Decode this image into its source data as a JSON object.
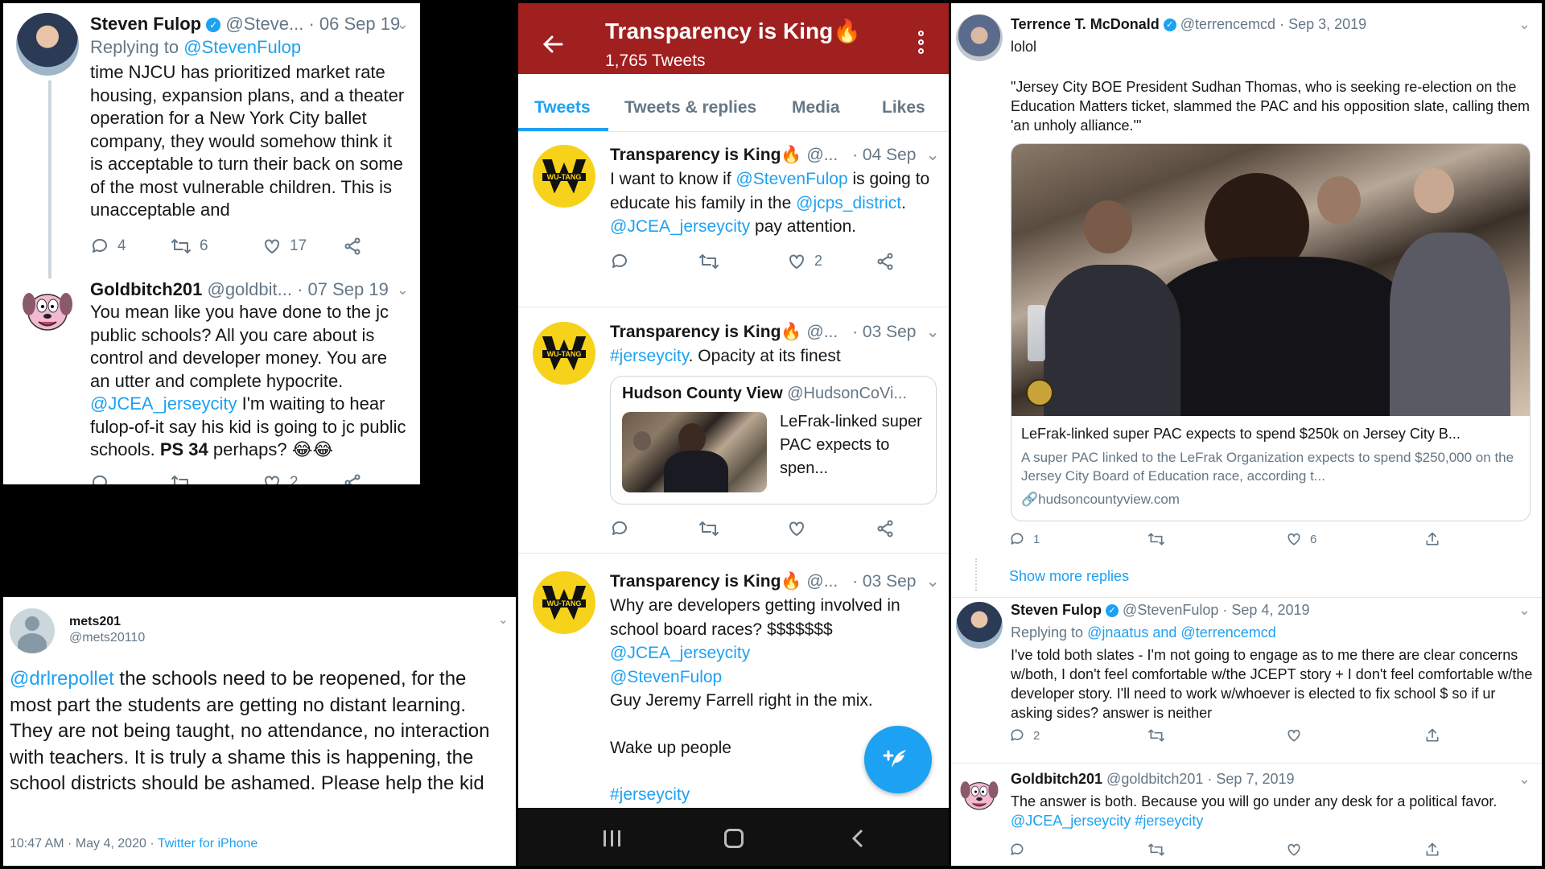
{
  "left_top": {
    "tweet1": {
      "name": "Steven Fulop",
      "handle": "@Steve...",
      "date": "· 06 Sep 19",
      "replying_prefix": "Replying to",
      "replying_to": "@StevenFulop",
      "body": "time NJCU has prioritized market rate housing, expansion plans, and a theater operation for a New York City ballet company, they would somehow think it is acceptable to turn their back on some of the most vulnerable children. This is unacceptable and",
      "replies": "4",
      "retweets": "6",
      "likes": "17"
    },
    "tweet2": {
      "name": "Goldbitch201",
      "handle": "@goldbit...",
      "date": "· 07 Sep 19",
      "body_before": "You mean like you have done to the jc public schools? All you care about is control and developer money. You are an utter and complete hypocrite.",
      "mention": "@JCEA_jerseycity",
      "body_after": " I'm waiting to hear fulop-of-it say his kid is going to jc public schools.",
      "bold": "PS 34",
      "body_end": " perhaps? 😂😂",
      "likes": "2"
    }
  },
  "left_bottom": {
    "name": "mets201",
    "handle": "@mets20110",
    "mention": "@drlrepollet",
    "body": " the schools need to be reopened, for the most part the students are getting no distant learning. They are not being taught, no attendance, no interaction with teachers. It is truly a shame this is happening, the school districts should be ashamed. Please help the kid",
    "timestamp": "10:47 AM · May 4, 2020 · ",
    "source": "Twitter for iPhone"
  },
  "middle": {
    "header_title": "Transparency is King🔥",
    "header_count": "1,765 Tweets",
    "tabs": [
      "Tweets",
      "Tweets & replies",
      "Media",
      "Likes"
    ],
    "author": "Transparency is King🔥",
    "author_handle": "@...",
    "tweet1": {
      "date": "· 04 Sep",
      "t1": "I want to know if ",
      "m1": "@StevenFulop",
      "t2": " is going to educate his family in the ",
      "m2": "@jcps_district",
      "t3": ".  ",
      "m3": "@JCEA_jerseycity",
      "t4": " pay attention.",
      "likes": "2"
    },
    "tweet2": {
      "date": "· 03 Sep",
      "hashtag": "#jerseycity",
      "text": ".  Opacity at its finest",
      "quote_name": "Hudson County View",
      "quote_handle": "@HudsonCoVi...",
      "quote_text": "LeFrak-linked super PAC expects to spen..."
    },
    "tweet3": {
      "date": "· 03 Sep",
      "text": "Why are developers getting involved in school board races? $$$$$$$",
      "m1": "@JCEA_jerseycity",
      "m2": "@StevenFulop",
      "line2": "Guy Jeremy Farrell right in the mix.",
      "line3": "Wake up people",
      "hashtag": "#jerseycity"
    },
    "logo_text": "WU-TANG"
  },
  "right": {
    "t1": {
      "name": "Terrence T. McDonald",
      "handle": "@terrencemcd",
      "date": "· Sep 3, 2019",
      "line1": "lolol",
      "quote": "\"Jersey City BOE President Sudhan Thomas, who is seeking re-election on the Education Matters ticket, slammed the PAC and his opposition slate, calling them 'an unholy alliance.'\"",
      "card_title": "LeFrak-linked super PAC expects to spend $250k on Jersey City B...",
      "card_desc": "A super PAC linked to the LeFrak Organization expects to spend $250,000 on the Jersey City Board of Education race, according t...",
      "card_link": "hudsoncountyview.com",
      "replies": "1",
      "likes": "6"
    },
    "show_more": "Show more replies",
    "t2": {
      "name": "Steven Fulop",
      "handle": "@StevenFulop",
      "date": "· Sep 4, 2019",
      "replying_prefix": "Replying to",
      "replying_to": "@jnaatus and @terrencemcd",
      "body": "I've told both slates - I'm not going to engage as to me there are clear concerns w/both, I don't feel comfortable w/the JCEPT story + I don't feel comfortable w/the developer story. I'll need to work w/whoever is elected to fix school $ so if ur asking sides? answer is neither",
      "replies": "2"
    },
    "t3": {
      "name": "Goldbitch201",
      "handle": "@goldbitch201",
      "date": "· Sep 7, 2019",
      "body": "The answer is both. Because you will go under any desk for a political favor. ",
      "tags": "@JCEA_jerseycity #jerseycity"
    }
  },
  "colors": {
    "twitter_blue": "#1da1f2",
    "header_red": "#a01f1f",
    "nav_black": "#111111",
    "wu_yellow": "#f7d21b"
  }
}
